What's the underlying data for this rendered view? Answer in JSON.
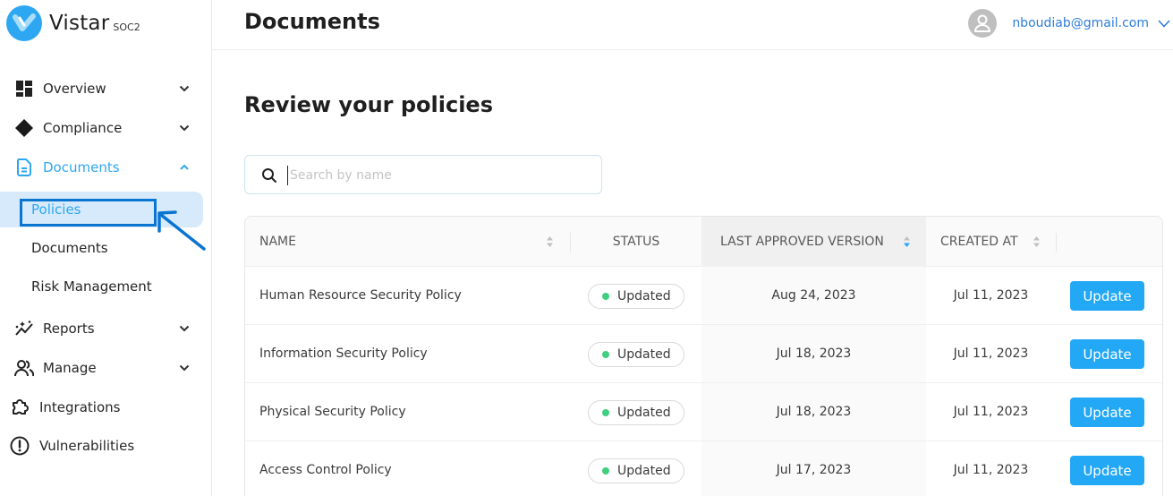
{
  "brand": {
    "name": "Vistar",
    "sub": "SOC2",
    "color": "#2ea7f2"
  },
  "header": {
    "title": "Documents",
    "user_email": "nboudiab@gmail.com"
  },
  "sidebar": {
    "items": [
      {
        "label": "Overview",
        "icon": "dashboard-icon",
        "expandable": true
      },
      {
        "label": "Compliance",
        "icon": "diamond-icon",
        "expandable": true
      },
      {
        "label": "Documents",
        "icon": "document-icon",
        "expandable": true,
        "expanded": true,
        "active": true,
        "children": [
          {
            "label": "Policies",
            "selected": true
          },
          {
            "label": "Documents"
          },
          {
            "label": "Risk Management"
          }
        ]
      },
      {
        "label": "Reports",
        "icon": "sparkle-chart-icon",
        "expandable": true
      },
      {
        "label": "Manage",
        "icon": "users-icon",
        "expandable": true
      },
      {
        "label": "Integrations",
        "icon": "puzzle-icon",
        "expandable": false
      },
      {
        "label": "Vulnerabilities",
        "icon": "alert-circle-icon",
        "expandable": false
      }
    ]
  },
  "main": {
    "section_title": "Review your policies",
    "search": {
      "placeholder": "Search by name",
      "value": ""
    },
    "table": {
      "columns": [
        {
          "label": "NAME",
          "sortable": true
        },
        {
          "label": "STATUS",
          "sortable": false
        },
        {
          "label": "LAST APPROVED VERSION",
          "sortable": true,
          "sorted": "descending"
        },
        {
          "label": "CREATED AT",
          "sortable": true
        },
        {
          "label": "",
          "sortable": false
        }
      ],
      "rows": [
        {
          "name": "Human Resource Security Policy",
          "status": "Updated",
          "last_approved": "Aug 24, 2023",
          "created_at": "Jul 11, 2023",
          "action": "Update"
        },
        {
          "name": "Information Security Policy",
          "status": "Updated",
          "last_approved": "Jul 18, 2023",
          "created_at": "Jul 11, 2023",
          "action": "Update"
        },
        {
          "name": "Physical Security Policy",
          "status": "Updated",
          "last_approved": "Jul 18, 2023",
          "created_at": "Jul 11, 2023",
          "action": "Update"
        },
        {
          "name": "Access Control Policy",
          "status": "Updated",
          "last_approved": "Jul 17, 2023",
          "created_at": "Jul 11, 2023",
          "action": "Update"
        }
      ]
    }
  },
  "colors": {
    "accent": "#2ea7f2",
    "status_ok": "#3fcf7f",
    "button": "#23a8f5",
    "annotation": "#0a74d1"
  }
}
